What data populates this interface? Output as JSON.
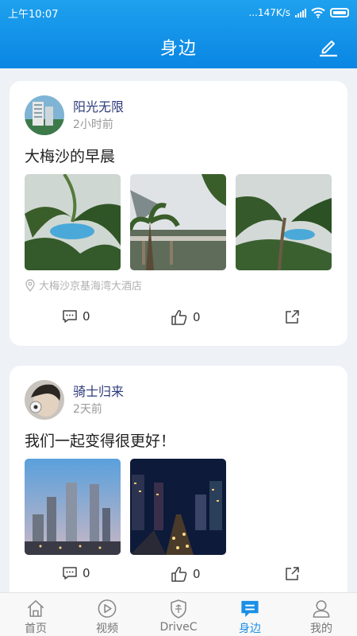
{
  "status_bar": {
    "time": "上午10:07",
    "speed": "...147K/s"
  },
  "header": {
    "title": "身边"
  },
  "posts": [
    {
      "author": "阳光无限",
      "time": "2小时前",
      "text": "大梅沙的早晨",
      "location": "大梅沙京基海湾大酒店",
      "comments": "0",
      "likes": "0"
    },
    {
      "author": "骑士归来",
      "time": "2天前",
      "text": "我们一起变得很更好！",
      "comments": "0",
      "likes": "0"
    }
  ],
  "tabs": [
    {
      "label": "首页",
      "icon": "home-icon"
    },
    {
      "label": "视频",
      "icon": "play-icon"
    },
    {
      "label": "DriveC",
      "icon": "shield-icon"
    },
    {
      "label": "身边",
      "icon": "chat-list-icon",
      "active": true
    },
    {
      "label": "我的",
      "icon": "user-icon"
    }
  ],
  "colors": {
    "accent": "#0a86e3",
    "author": "#2d3a7a",
    "muted": "#999999"
  }
}
